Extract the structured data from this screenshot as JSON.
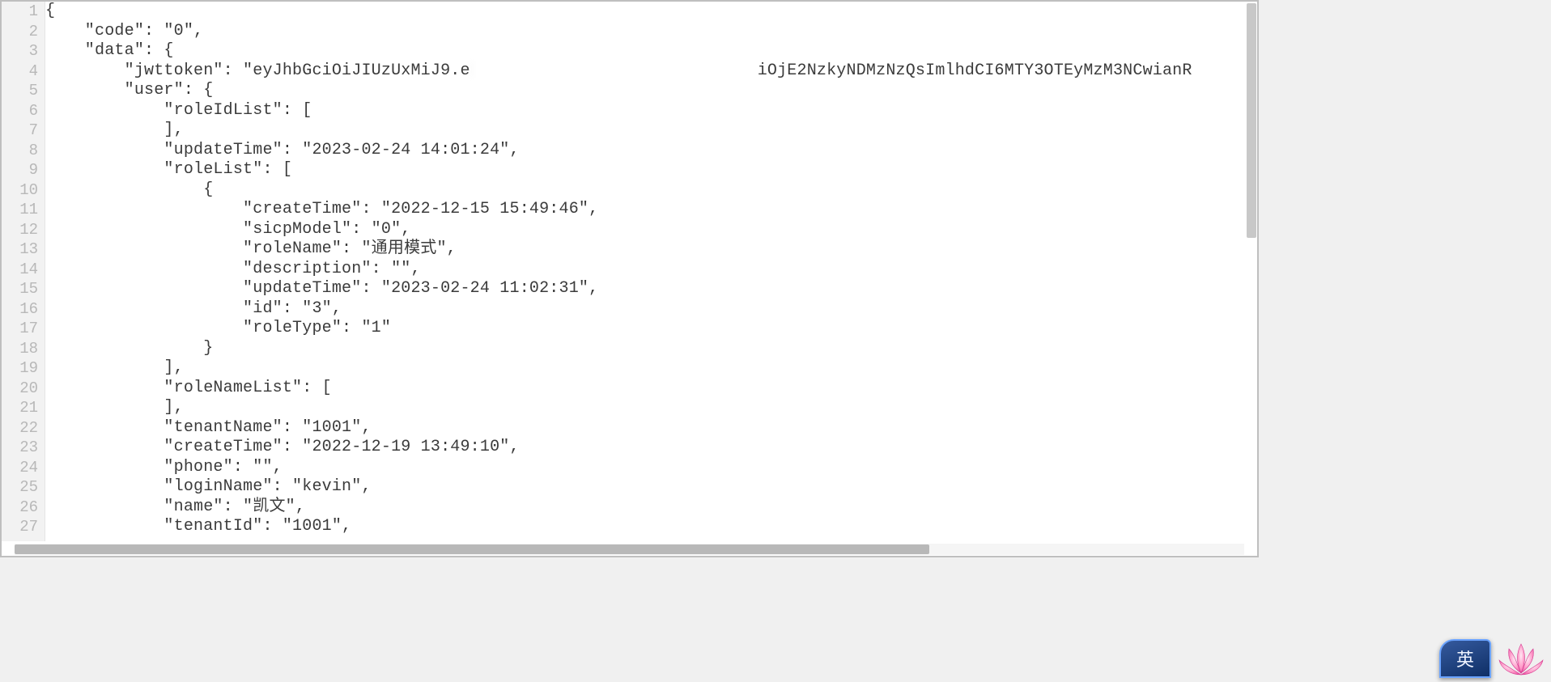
{
  "gutter": {
    "start": 1,
    "end": 27
  },
  "code": {
    "lines": [
      "{",
      "    \"code\": \"0\",",
      "    \"data\": {",
      "        \"jwttoken\": \"eyJhbGciOiJIUzUxMiJ9.e                                 iOjE2NzkyNDMzNzQsImlhdCI6MTY3OTEyMzM3NCwianR",
      "        \"user\": {",
      "            \"roleIdList\": [",
      "            ],",
      "            \"updateTime\": \"2023-02-24 14:01:24\",",
      "            \"roleList\": [",
      "                {",
      "                    \"createTime\": \"2022-12-15 15:49:46\",",
      "                    \"sicpModel\": \"0\",",
      "                    \"roleName\": \"通用模式\",",
      "                    \"description\": \"\",",
      "                    \"updateTime\": \"2023-02-24 11:02:31\",",
      "                    \"id\": \"3\",",
      "                    \"roleType\": \"1\"",
      "                }",
      "            ],",
      "            \"roleNameList\": [",
      "            ],",
      "            \"tenantName\": \"1001\",",
      "            \"createTime\": \"2022-12-19 13:49:10\",",
      "            \"phone\": \"\",",
      "            \"loginName\": \"kevin\",",
      "            \"name\": \"凯文\",",
      "            \"tenantId\": \"1001\","
    ]
  },
  "ime": {
    "label": "英"
  },
  "redacted_line_index": 3
}
